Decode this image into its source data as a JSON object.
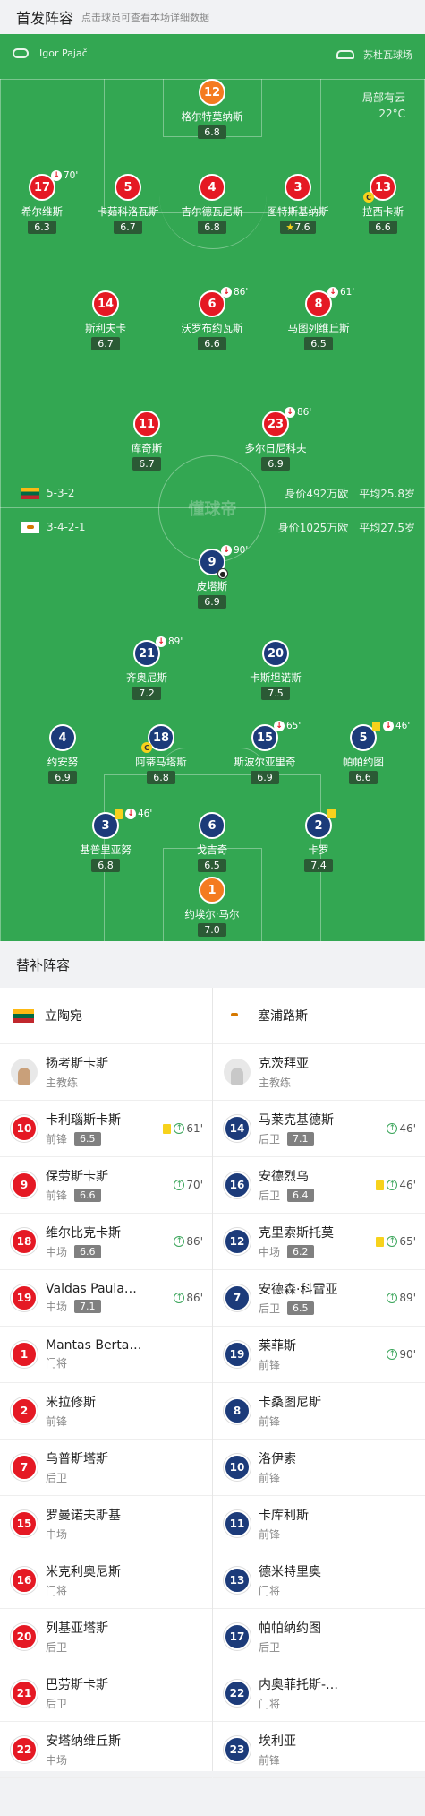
{
  "header": {
    "title": "首发阵容",
    "hint": "点击球员可查看本场详细数据"
  },
  "pitch": {
    "referee": "Igor Pajač",
    "stadium": "苏杜瓦球场",
    "weather": "局部有云",
    "temperature": "22°C",
    "watermark": "懂球帝",
    "home": {
      "formation": "5-3-2",
      "value": "身价492万欧",
      "age": "平均25.8岁"
    },
    "away": {
      "formation": "3-4-2-1",
      "value": "身价1025万欧",
      "age": "平均27.5岁"
    },
    "players": [
      {
        "num": "12",
        "name": "格尔特莫纳斯",
        "rating": "6.8",
        "team": "gk1"
      },
      {
        "num": "17",
        "name": "希尔维斯",
        "rating": "6.3",
        "team": "red",
        "sub": "70'"
      },
      {
        "num": "5",
        "name": "卡茹科洛瓦斯",
        "rating": "6.7",
        "team": "red"
      },
      {
        "num": "4",
        "name": "吉尔德瓦尼斯",
        "rating": "6.8",
        "team": "red"
      },
      {
        "num": "3",
        "name": "图特斯基纳斯",
        "rating": "7.6",
        "team": "red",
        "star": true
      },
      {
        "num": "13",
        "name": "拉西卡斯",
        "rating": "6.6",
        "team": "red",
        "captain": "C"
      },
      {
        "num": "14",
        "name": "斯利夫卡",
        "rating": "6.7",
        "team": "red"
      },
      {
        "num": "6",
        "name": "沃罗布约瓦斯",
        "rating": "6.6",
        "team": "red",
        "sub": "86'"
      },
      {
        "num": "8",
        "name": "马图列维丘斯",
        "rating": "6.5",
        "team": "red",
        "sub": "61'"
      },
      {
        "num": "11",
        "name": "库奇斯",
        "rating": "6.7",
        "team": "red"
      },
      {
        "num": "23",
        "name": "多尔日尼科夫",
        "rating": "6.9",
        "team": "red",
        "sub": "86'"
      },
      {
        "num": "9",
        "name": "皮塔斯",
        "rating": "6.9",
        "team": "blue",
        "sub": "90'",
        "ball": true
      },
      {
        "num": "21",
        "name": "齐奥尼斯",
        "rating": "7.2",
        "team": "blue",
        "sub": "89'"
      },
      {
        "num": "20",
        "name": "卡斯坦诺斯",
        "rating": "7.5",
        "team": "blue"
      },
      {
        "num": "4",
        "name": "约安努",
        "rating": "6.9",
        "team": "blue"
      },
      {
        "num": "18",
        "name": "阿蒂马塔斯",
        "rating": "6.8",
        "team": "blue",
        "captain": "C"
      },
      {
        "num": "15",
        "name": "斯波尔亚里奇",
        "rating": "6.9",
        "team": "blue",
        "sub": "65'"
      },
      {
        "num": "5",
        "name": "帕帕约图",
        "rating": "6.6",
        "team": "blue",
        "sub": "46'",
        "yellow": true
      },
      {
        "num": "3",
        "name": "基普里亚努",
        "rating": "6.8",
        "team": "blue",
        "sub": "46'",
        "yellow": true
      },
      {
        "num": "6",
        "name": "戈吉奇",
        "rating": "6.5",
        "team": "blue"
      },
      {
        "num": "2",
        "name": "卡罗",
        "rating": "7.4",
        "team": "blue",
        "yellow": true
      },
      {
        "num": "1",
        "name": "约埃尔·马尔",
        "rating": "7.0",
        "team": "gk2"
      }
    ]
  },
  "subs_header": {
    "title": "替补阵容"
  },
  "home_team": {
    "name": "立陶宛"
  },
  "away_team": {
    "name": "塞浦路斯"
  },
  "home_coach": {
    "name": "扬考斯卡斯",
    "role": "主教练"
  },
  "away_coach": {
    "name": "克茨拜亚",
    "role": "主教练"
  },
  "home_subs": [
    {
      "num": "10",
      "name": "卡利瑙斯卡斯",
      "pos": "前锋",
      "rating": "6.5",
      "yellow": true,
      "time": "61'"
    },
    {
      "num": "9",
      "name": "保劳斯卡斯",
      "pos": "前锋",
      "rating": "6.6",
      "time": "70'"
    },
    {
      "num": "18",
      "name": "维尔比克卡斯",
      "pos": "中场",
      "rating": "6.6",
      "time": "86'"
    },
    {
      "num": "19",
      "name": "Valdas Paula…",
      "pos": "中场",
      "rating": "7.1",
      "time": "86'"
    },
    {
      "num": "1",
      "name": "Mantas Berta…",
      "pos": "门将"
    },
    {
      "num": "2",
      "name": "米拉修斯",
      "pos": "前锋"
    },
    {
      "num": "7",
      "name": "乌普斯塔斯",
      "pos": "后卫"
    },
    {
      "num": "15",
      "name": "罗曼诺夫斯基",
      "pos": "中场"
    },
    {
      "num": "16",
      "name": "米克利奥尼斯",
      "pos": "门将"
    },
    {
      "num": "20",
      "name": "列基亚塔斯",
      "pos": "后卫"
    },
    {
      "num": "21",
      "name": "巴劳斯卡斯",
      "pos": "后卫"
    },
    {
      "num": "22",
      "name": "安塔纳维丘斯",
      "pos": "中场"
    }
  ],
  "away_subs": [
    {
      "num": "14",
      "name": "马莱克基德斯",
      "pos": "后卫",
      "rating": "7.1",
      "time": "46'"
    },
    {
      "num": "16",
      "name": "安德烈乌",
      "pos": "后卫",
      "rating": "6.4",
      "yellow": true,
      "time": "46'"
    },
    {
      "num": "12",
      "name": "克里索斯托莫",
      "pos": "中场",
      "rating": "6.2",
      "yellow": true,
      "time": "65'"
    },
    {
      "num": "7",
      "name": "安德森·科雷亚",
      "pos": "后卫",
      "rating": "6.5",
      "time": "89'"
    },
    {
      "num": "19",
      "name": "莱菲斯",
      "pos": "前锋",
      "time": "90'"
    },
    {
      "num": "8",
      "name": "卡桑图尼斯",
      "pos": "前锋"
    },
    {
      "num": "10",
      "name": "洛伊索",
      "pos": "前锋"
    },
    {
      "num": "11",
      "name": "卡库利斯",
      "pos": "前锋"
    },
    {
      "num": "13",
      "name": "德米特里奥",
      "pos": "门将"
    },
    {
      "num": "17",
      "name": "帕帕纳约图",
      "pos": "后卫"
    },
    {
      "num": "22",
      "name": "内奥菲托斯-…",
      "pos": "门将"
    },
    {
      "num": "23",
      "name": "埃利亚",
      "pos": "前锋"
    }
  ]
}
